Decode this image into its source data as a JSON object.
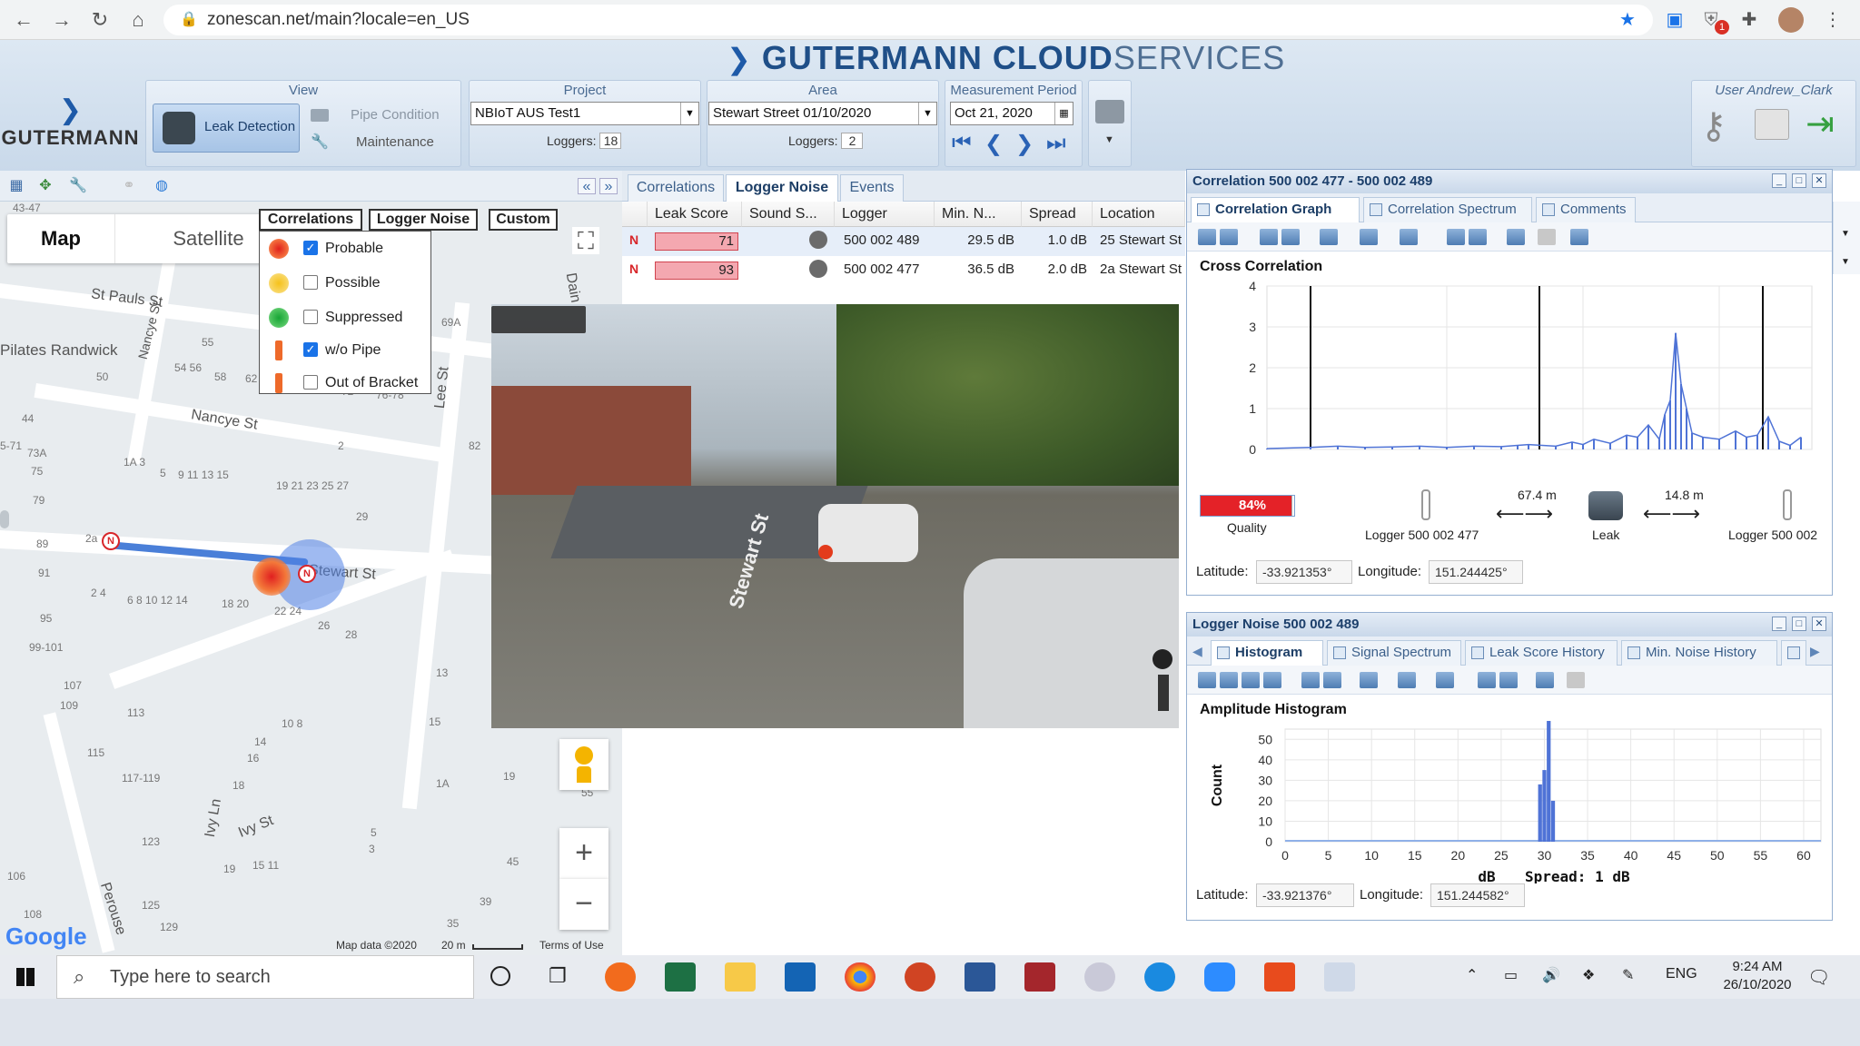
{
  "browser": {
    "url": "zonescan.net/main?locale=en_US",
    "badge": "1"
  },
  "header": {
    "brand_bold": "GUTERMANN CLOUD",
    "brand_thin": "SERVICES",
    "logo_text": "GUTERMANN"
  },
  "view": {
    "title": "View",
    "leak_detection": "Leak Detection",
    "pipe_condition": "Pipe Condition",
    "maintenance": "Maintenance"
  },
  "project": {
    "title": "Project",
    "value": "NBIoT AUS Test1",
    "loggers_label": "Loggers:",
    "loggers_count": "18"
  },
  "area": {
    "title": "Area",
    "value": "Stewart Street 01/10/2020",
    "loggers_label": "Loggers:",
    "loggers_count": "2"
  },
  "period": {
    "title": "Measurement Period",
    "date": "Oct 21, 2020"
  },
  "user": {
    "label": "User Andrew_Clark"
  },
  "map": {
    "map_btn": "Map",
    "satellite_btn": "Satellite",
    "legend_tabs": [
      "Correlations",
      "Logger Noise",
      "Custom"
    ],
    "legend": [
      {
        "label": "Probable",
        "checked": true
      },
      {
        "label": "Possible",
        "checked": false
      },
      {
        "label": "Suppressed",
        "checked": false
      },
      {
        "label": "w/o Pipe",
        "checked": true
      },
      {
        "label": "Out of Bracket",
        "checked": false
      }
    ],
    "streets": [
      "St Pauls St",
      "Nancye St",
      "Lee St",
      "Stewart St",
      "Ivy St",
      "Ivy Ln",
      "Perouse",
      "Dain",
      "Pilates Randwick",
      "Nancye St"
    ],
    "attribution": "Map data ©2020",
    "scale": "20 m",
    "terms": "Terms of Use",
    "google": "Google",
    "coords_corner": "43-47",
    "streetview_label": "Stewart St"
  },
  "center": {
    "tabs": [
      "Correlations",
      "Logger Noise",
      "Events"
    ],
    "columns": [
      "Leak Score",
      "Sound S...",
      "Logger",
      "Min. N...",
      "Spread",
      "Location"
    ],
    "rows": [
      {
        "score": "71",
        "logger": "500 002 489",
        "min_noise": "29.5 dB",
        "spread": "1.0 dB",
        "location": "25 Stewart St"
      },
      {
        "score": "93",
        "logger": "500 002 477",
        "min_noise": "36.5 dB",
        "spread": "2.0 dB",
        "location": "2a Stewart St"
      }
    ]
  },
  "correlation": {
    "title": "Correlation 500 002 477 - 500 002 489",
    "tabs": [
      "Correlation Graph",
      "Correlation Spectrum",
      "Comments"
    ],
    "chart_title": "Cross Correlation",
    "quality": "84%",
    "quality_label": "Quality",
    "logger_left": "Logger 500 002 477",
    "logger_right": "Logger 500 002",
    "leak": "Leak",
    "dist_left": "67.4 m",
    "dist_right": "14.8 m",
    "latitude_label": "Latitude:",
    "latitude": "-33.921353°",
    "longitude_label": "Longitude:",
    "longitude": "151.244425°"
  },
  "noise": {
    "title": "Logger Noise 500 002 489",
    "tabs": [
      "Histogram",
      "Signal Spectrum",
      "Leak Score History",
      "Min. Noise History"
    ],
    "chart_title": "Amplitude Histogram",
    "spread": "Spread: 1 dB",
    "latitude_label": "Latitude:",
    "latitude": "-33.921376°",
    "longitude_label": "Longitude:",
    "longitude": "151.244582°"
  },
  "chart_data": [
    {
      "type": "line",
      "title": "Cross Correlation",
      "xlabel": "m",
      "ylabel": "",
      "xlim": [
        -8,
        92
      ],
      "ylim": [
        0,
        4
      ],
      "xticks": [
        0,
        25,
        50,
        75
      ],
      "yticks": [
        0,
        1,
        2,
        3,
        4
      ],
      "markers": [
        0,
        42,
        83
      ],
      "x": [
        -8,
        0,
        5,
        10,
        15,
        20,
        25,
        30,
        35,
        38,
        40,
        45,
        48,
        50,
        52,
        55,
        58,
        60,
        62,
        64,
        65,
        66,
        67,
        68,
        69,
        70,
        72,
        75,
        78,
        80,
        82,
        84,
        86,
        88,
        90
      ],
      "values": [
        0.02,
        0.05,
        0.08,
        0.05,
        0.06,
        0.08,
        0.05,
        0.08,
        0.07,
        0.1,
        0.12,
        0.08,
        0.18,
        0.12,
        0.25,
        0.15,
        0.35,
        0.3,
        0.6,
        0.25,
        0.85,
        1.2,
        2.85,
        1.6,
        1.0,
        0.4,
        0.3,
        0.25,
        0.45,
        0.3,
        0.35,
        0.8,
        0.2,
        0.1,
        0.3
      ]
    },
    {
      "type": "bar",
      "title": "Amplitude Histogram",
      "xlabel": "dB",
      "ylabel": "Count",
      "xlim": [
        0,
        62
      ],
      "ylim": [
        0,
        55
      ],
      "xticks": [
        0,
        5,
        10,
        15,
        20,
        25,
        30,
        35,
        40,
        45,
        50,
        55,
        60
      ],
      "yticks": [
        0,
        10,
        20,
        30,
        40,
        50
      ],
      "x": [
        29.5,
        30,
        30.5,
        31
      ],
      "values": [
        28,
        35,
        59,
        20
      ]
    }
  ],
  "taskbar": {
    "search": "Type here to search",
    "lang": "ENG",
    "time": "9:24 AM",
    "date": "26/10/2020"
  }
}
